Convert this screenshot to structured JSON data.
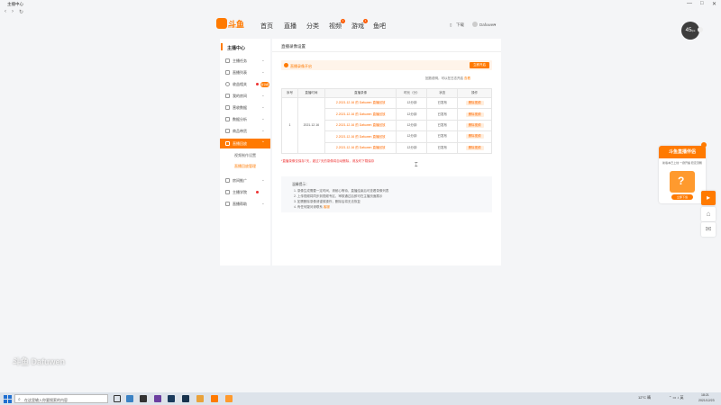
{
  "window": {
    "title": "主播中心",
    "controls": [
      "—",
      "□",
      "✕"
    ]
  },
  "browser": {
    "url_hint": "< >  ↻"
  },
  "site": {
    "logo_text": "斗鱼",
    "logo_sub": "DOUYU.COM",
    "nav": [
      {
        "label": "首页"
      },
      {
        "label": "直播"
      },
      {
        "label": "分类"
      },
      {
        "label": "视频",
        "badge": "1"
      },
      {
        "label": "游戏",
        "badge": "1"
      },
      {
        "label": "鱼吧"
      }
    ],
    "right": {
      "download": "下载",
      "user": "Dafuwen"
    }
  },
  "sidebar": {
    "title": "主播中心",
    "items": [
      {
        "label": "主播任务",
        "icon": "task-icon"
      },
      {
        "label": "直播列表",
        "icon": "list-icon"
      },
      {
        "label": "收益相关",
        "icon": "money-icon",
        "dot": true
      },
      {
        "label": "我的房间",
        "icon": "room-icon"
      },
      {
        "label": "营收数据",
        "icon": "revenue-icon"
      },
      {
        "label": "数据分析",
        "icon": "chart-icon"
      },
      {
        "label": "商品带货",
        "icon": "shop-icon"
      },
      {
        "label": "直播回放",
        "icon": "replay-icon",
        "active": true
      }
    ],
    "subitems": [
      {
        "label": "视频制作设置"
      },
      {
        "label": "直播回放管理",
        "active": true
      }
    ],
    "items_after": [
      {
        "label": "房间推广",
        "icon": "promote-icon"
      },
      {
        "label": "主播学院",
        "icon": "school-icon",
        "dot": true
      },
      {
        "label": "直播帮助",
        "icon": "help-icon"
      }
    ],
    "new_badge": "新功能"
  },
  "main": {
    "title": "直播录像设置",
    "banner": {
      "text": "直播录像开启",
      "button": "立即开启"
    },
    "note": {
      "text": "回放说明，可以在日志开启",
      "link": "查看"
    },
    "table": {
      "headers": [
        "序号",
        "直播时间",
        "直播录像",
        "时长（分）",
        "状态",
        "操作"
      ],
      "rows": [
        {
          "index": "1",
          "date": "2021.12.16",
          "segments": [
            {
              "rec": "2.2021.12.16 的 Dafuwen 直播回放",
              "dur": "12分钟",
              "status": "已发布",
              "op": "删除视频"
            },
            {
              "rec": "2.2021.12.16 的 Dafuwen 直播回放",
              "dur": "12分钟",
              "status": "已发布",
              "op": "删除视频"
            },
            {
              "rec": "2.2021.12.16 的 Dafuwen 直播回放",
              "dur": "12分钟",
              "status": "已发布",
              "op": "删除视频"
            },
            {
              "rec": "2.2021.12.16 的 Dafuwen 直播回放",
              "dur": "12分钟",
              "status": "已发布",
              "op": "删除视频"
            },
            {
              "rec": "2.2021.12.16 的 Dafuwen 直播回放",
              "dur": "12分钟",
              "status": "已发布",
              "op": "删除视频"
            }
          ]
        }
      ]
    },
    "warning": "*直播录像仅保存7天，超过7天的录像将自动删除，请及时下载保存",
    "tips": {
      "heading": "温馨提示：",
      "lines": [
        {
          "text": "1. 录像生成需要一定时间，请耐心等待，直播结束后可查看录像列表"
        },
        {
          "text": "2. 上传视频将同步到视频专区，审核通过后即可在主播页面展示"
        },
        {
          "text": "3. 如需删除录像请谨慎操作，删除后将无法恢复"
        },
        {
          "text": "4. 有任何疑问请联系",
          "link": "客服"
        }
      ]
    }
  },
  "widgets": {
    "fps": "45",
    "fps_unit": "fps",
    "promo": {
      "title": "斗鱼直播伴侣",
      "subtitle": "新版本已上线 一键开播 稳定流畅",
      "cta": "立即下载"
    }
  },
  "watermark": "斗鱼  Dafuwen",
  "taskbar": {
    "search_placeholder": "在这里输入你要搜索的内容",
    "weather": "12°C 晴",
    "time": "18:21",
    "date": "2021/12/23"
  }
}
